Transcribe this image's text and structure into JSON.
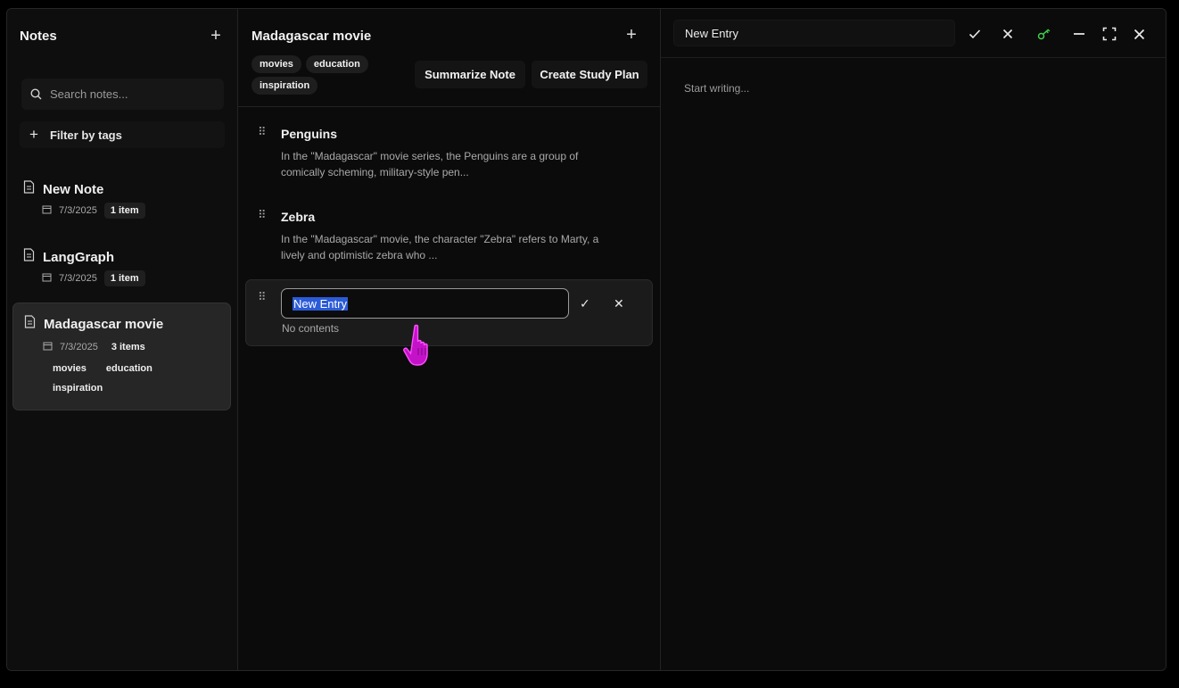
{
  "sidebar": {
    "title": "Notes",
    "add_icon": "plus-icon",
    "search_placeholder": "Search notes...",
    "filter_label": "Filter by tags",
    "notes": [
      {
        "title": "New Note",
        "date": "7/3/2025",
        "count": "1 item",
        "tags": []
      },
      {
        "title": "LangGraph",
        "date": "7/3/2025",
        "count": "1 item",
        "tags": []
      },
      {
        "title": "Madagascar movie",
        "date": "7/3/2025",
        "count": "3 items",
        "tags": [
          "movies",
          "education",
          "inspiration"
        ]
      }
    ]
  },
  "middle": {
    "title": "Madagascar movie",
    "tags": [
      "movies",
      "education",
      "inspiration"
    ],
    "summarize_label": "Summarize Note",
    "study_plan_label": "Create Study Plan",
    "entries": [
      {
        "title": "Penguins",
        "body": "In the \"Madagascar\" movie series, the Penguins are a group of comically scheming, military-style pen..."
      },
      {
        "title": "Zebra",
        "body": "In the \"Madagascar\" movie, the character \"Zebra\" refers to Marty, a lively and optimistic zebra who ..."
      }
    ],
    "editing_entry": {
      "value": "New Entry",
      "subtitle": "No contents"
    }
  },
  "editor": {
    "title_value": "New Entry",
    "body_placeholder": "Start writing...",
    "accent_color": "#3ecf4a"
  },
  "cursor": {
    "color": "#e020e0"
  }
}
